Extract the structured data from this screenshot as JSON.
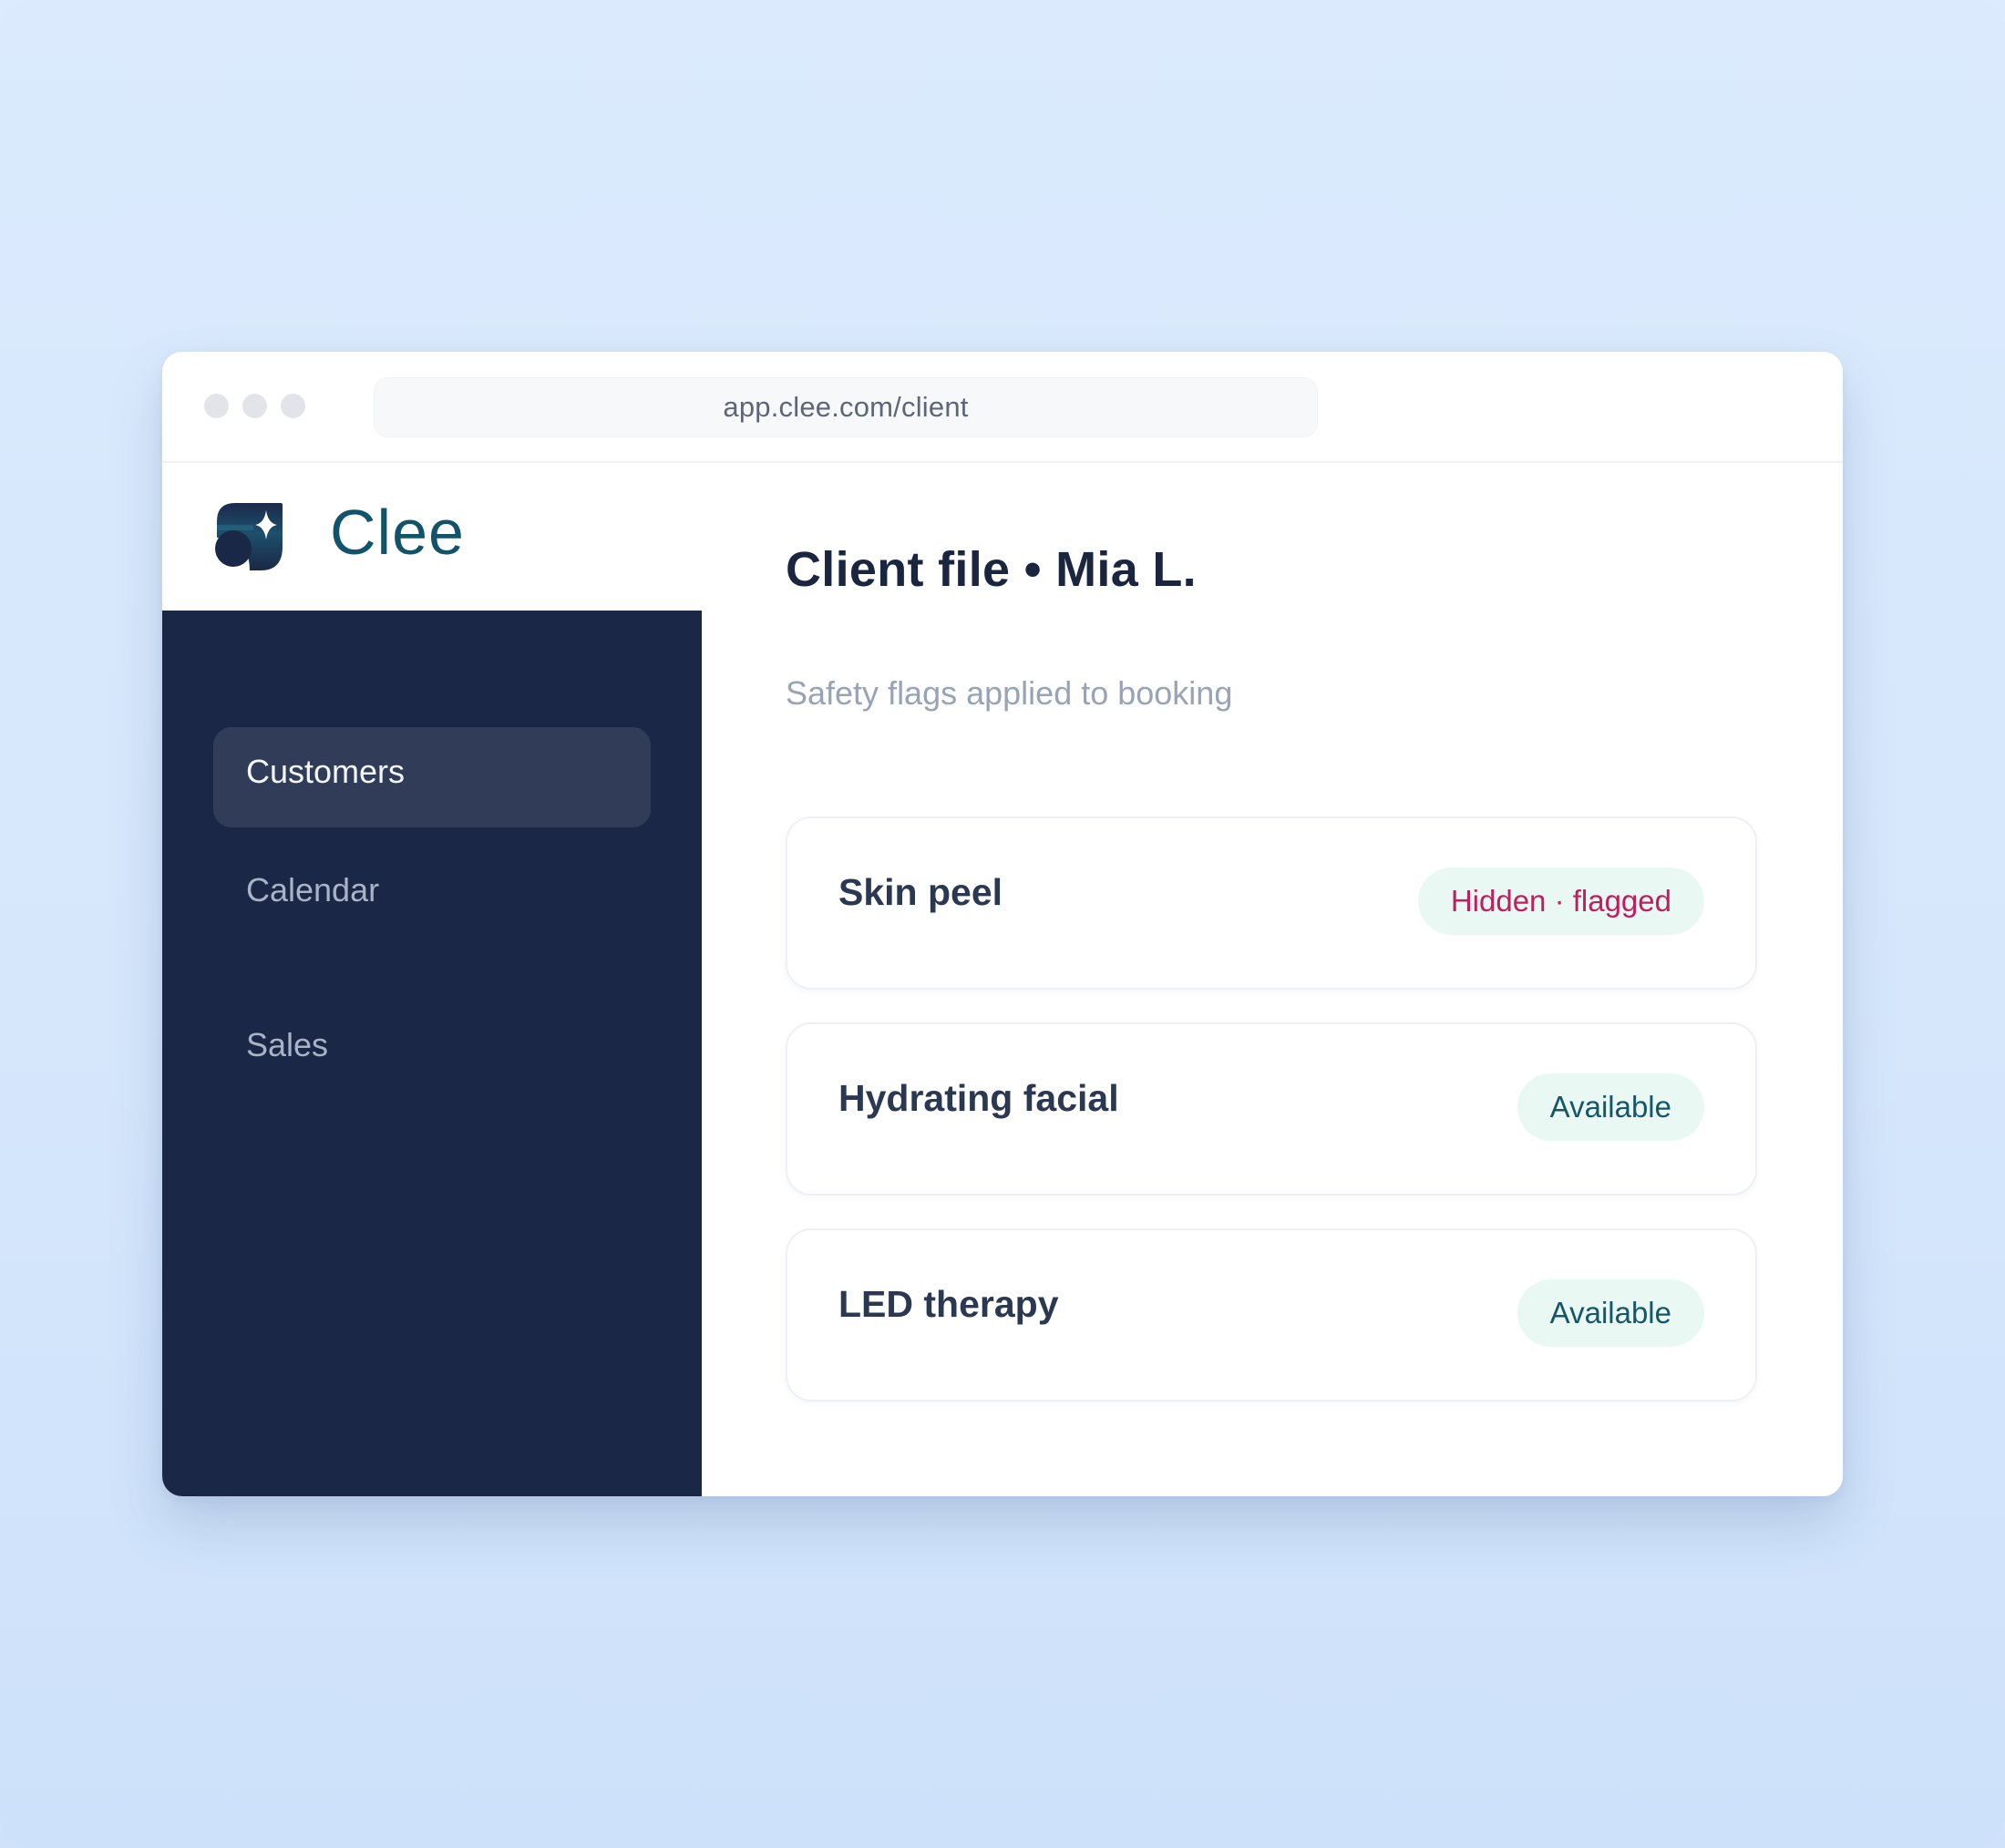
{
  "browser": {
    "url": "app.clee.com/client"
  },
  "brand": {
    "name": "Clee",
    "logo_icon": "clee-logo-icon",
    "color": "#11536b"
  },
  "sidebar": {
    "items": [
      {
        "label": "Customers",
        "active": true
      },
      {
        "label": "Calendar",
        "active": false
      },
      {
        "label": "Sales",
        "active": false
      }
    ]
  },
  "main": {
    "title": "Client file • Mia L.",
    "subtitle": "Safety flags applied to booking",
    "treatments": [
      {
        "name": "Skin peel",
        "status": "Hidden · flagged",
        "status_type": "flagged"
      },
      {
        "name": "Hydrating facial",
        "status": "Available",
        "status_type": "available"
      },
      {
        "name": "LED therapy",
        "status": "Available",
        "status_type": "available"
      }
    ]
  },
  "colors": {
    "sidebar_bg": "#1b2747",
    "active_item_bg": "#313d58",
    "flagged_text": "#c01e5e",
    "available_text": "#16566b",
    "badge_bg": "#eaf8f4"
  }
}
